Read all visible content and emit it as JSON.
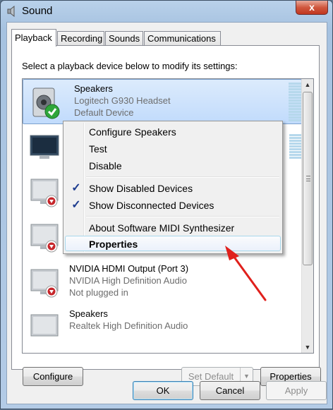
{
  "window": {
    "title": "Sound",
    "close_label": "x",
    "icons": {
      "title": "speaker-icon",
      "close": "close-icon"
    }
  },
  "tabs": [
    {
      "label": "Playback",
      "active": true
    },
    {
      "label": "Recording",
      "active": false
    },
    {
      "label": "Sounds",
      "active": false
    },
    {
      "label": "Communications",
      "active": false
    }
  ],
  "instruction": "Select a playback device below to modify its settings:",
  "devices": [
    {
      "name": "Speakers",
      "sub1": "Logitech G930 Headset",
      "sub2": "Default Device",
      "icon": "speaker-icon",
      "badge": "check-icon",
      "selected": true
    },
    {
      "name": "",
      "sub1": "",
      "sub2": "",
      "icon": "monitor-icon",
      "badge": "",
      "selected": false
    },
    {
      "name": "",
      "sub1": "",
      "sub2": "",
      "icon": "monitor-icon",
      "badge": "disconnected-icon",
      "selected": false
    },
    {
      "name": "",
      "sub1": "",
      "sub2": "",
      "icon": "monitor-icon",
      "badge": "disconnected-icon",
      "selected": false
    },
    {
      "name": "NVIDIA HDMI Output (Port 3)",
      "sub1": "NVIDIA High Definition Audio",
      "sub2": "Not plugged in",
      "icon": "monitor-icon",
      "badge": "disconnected-icon",
      "selected": false
    },
    {
      "name": "Speakers",
      "sub1": "Realtek High Definition Audio",
      "sub2": "",
      "icon": "speaker-icon",
      "badge": "",
      "selected": false
    }
  ],
  "context_menu": {
    "items": [
      {
        "label": "Configure Speakers"
      },
      {
        "label": "Test"
      },
      {
        "label": "Disable"
      },
      {
        "label": "Show Disabled Devices",
        "checked": true
      },
      {
        "label": "Show Disconnected Devices",
        "checked": true
      },
      {
        "label": "About Software MIDI Synthesizer"
      },
      {
        "label": "Properties",
        "bold": true,
        "highlighted": true
      }
    ],
    "check_glyph": "✓"
  },
  "buttons": {
    "configure": "Configure",
    "set_default": "Set Default",
    "properties": "Properties",
    "ok": "OK",
    "cancel": "Cancel",
    "apply": "Apply"
  },
  "annotation": {
    "color": "#e0201c",
    "icon": "red-arrow-icon"
  }
}
